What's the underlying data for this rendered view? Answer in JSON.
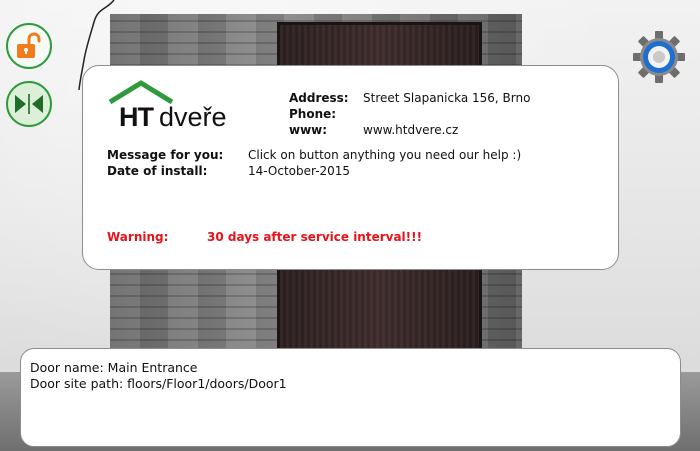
{
  "company": {
    "logo_bold": "HT",
    "logo_light": "dveře",
    "brand_color": "#2e9a3c"
  },
  "contact": {
    "address_label": "Address:",
    "address_value": "Street Slapanicka 156, Brno",
    "phone_label": "Phone:",
    "phone_value": "",
    "www_label": "www:",
    "www_value": "www.htdvere.cz"
  },
  "message": {
    "label": "Message for you:",
    "value": "Click on button anything you need our help :)"
  },
  "install": {
    "label": "Date of install:",
    "value": "14-October-2015"
  },
  "warning": {
    "label": "Warning:",
    "value": "30 days after service interval!!!",
    "color": "#e8141a"
  },
  "door_info": {
    "name_line": "Door name: Main Entrance",
    "path_line": "Door site path: floors/Floor1/doors/Door1"
  },
  "controls": {
    "lock_icon": "unlocked-padlock-icon",
    "split_icon": "split-arrows-icon",
    "settings_icon": "gear-icon",
    "lock_color": "#f07c1e"
  }
}
